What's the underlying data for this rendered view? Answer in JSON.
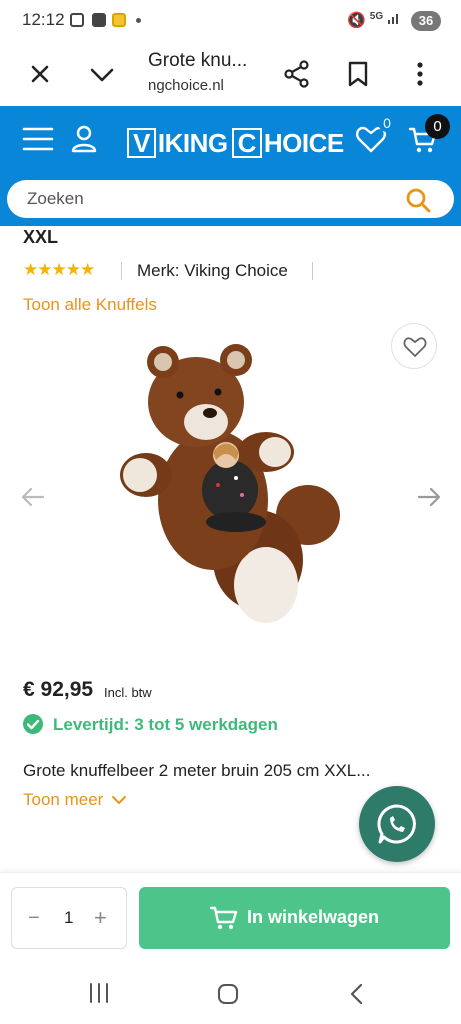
{
  "status_bar": {
    "time": "12:12",
    "network": "5G",
    "battery": "36"
  },
  "browser": {
    "tab_title": "Grote knu...",
    "url": "ngchoice.nl"
  },
  "site": {
    "logo_part1": "V",
    "logo_part2": "IKING",
    "logo_part3": "C",
    "logo_part4": "HOICE",
    "wishlist_count": "0",
    "cart_count": "0",
    "search_placeholder": "Zoeken",
    "brand_color": "#0a86d8",
    "accent_color": "#e8941a",
    "success_color": "#3dba7a"
  },
  "product": {
    "title_fragment": "XXL",
    "rating_stars": 5,
    "brand_label": "Merk: Viking Choice",
    "category_link": "Toon alle Knuffels",
    "price": "€ 92,95",
    "price_note": "Incl. btw",
    "delivery": "Levertijd: 3 tot 5 werkdagen",
    "description": "Grote knuffelbeer 2 meter bruin 205 cm XXL...",
    "show_more": "Toon meer"
  },
  "cart": {
    "quantity": "1",
    "minus": "−",
    "plus": "+",
    "add_label": "In winkelwagen"
  }
}
